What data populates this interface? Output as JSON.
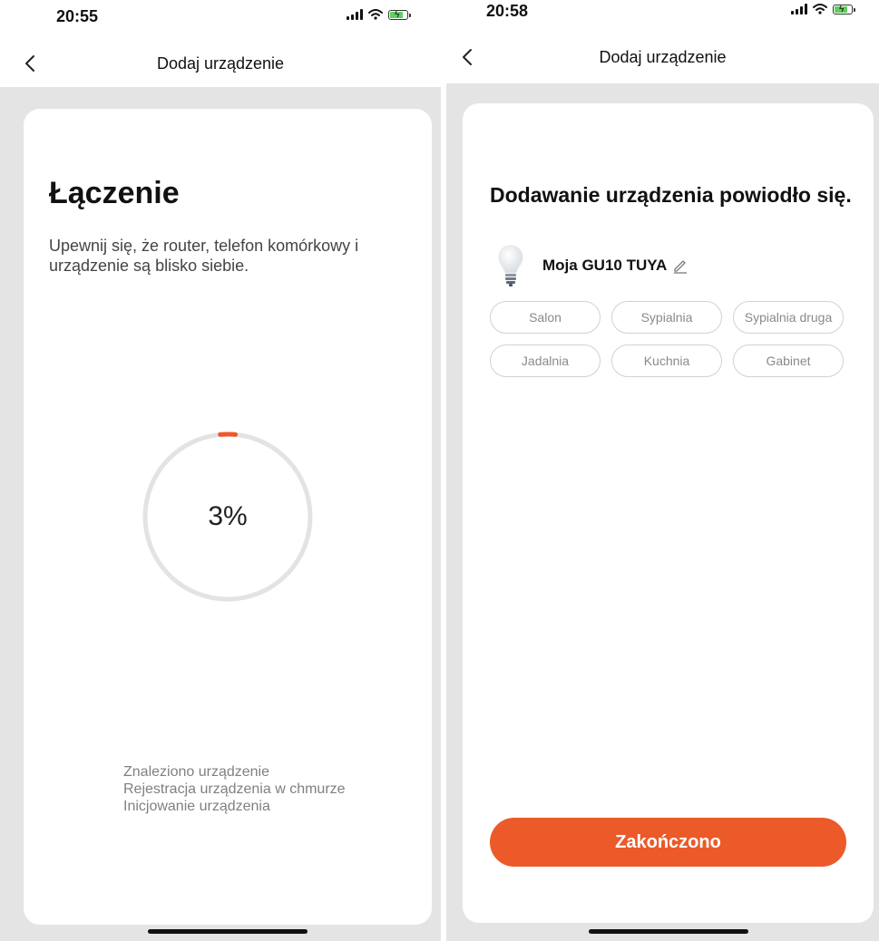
{
  "left": {
    "status_bar": {
      "time": "20:55"
    },
    "nav": {
      "title": "Dodaj urządzenie"
    },
    "connecting": {
      "title": "Łączenie",
      "description": "Upewnij się, że router, telefon komórkowy i urządzenie są blisko siebie.",
      "progress_label": "3%",
      "progress_fraction": 0.03,
      "accent_color": "#ec5a2a",
      "track_color": "#e3e3e3",
      "steps": [
        "Znaleziono urządzenie",
        "Rejestracja urządzenia w chmurze",
        "Inicjowanie urządzenia"
      ]
    }
  },
  "right": {
    "status_bar": {
      "time": "20:58"
    },
    "nav": {
      "title": "Dodaj urządzenie"
    },
    "success": {
      "title": "Dodawanie urządzenia powiodło się.",
      "device_name": "Moja GU10 TUYA",
      "rooms": [
        "Salon",
        "Sypialnia",
        "Sypialnia druga",
        "Jadalnia",
        "Kuchnia",
        "Gabinet"
      ],
      "finish_label": "Zakończono",
      "button_color": "#ec5a2a"
    }
  },
  "icons": {
    "back": "chevron-left-icon",
    "signal": "cellular-signal-icon",
    "wifi": "wifi-icon",
    "battery": "battery-charging-icon",
    "bulb": "light-bulb-icon",
    "edit": "pencil-icon"
  }
}
